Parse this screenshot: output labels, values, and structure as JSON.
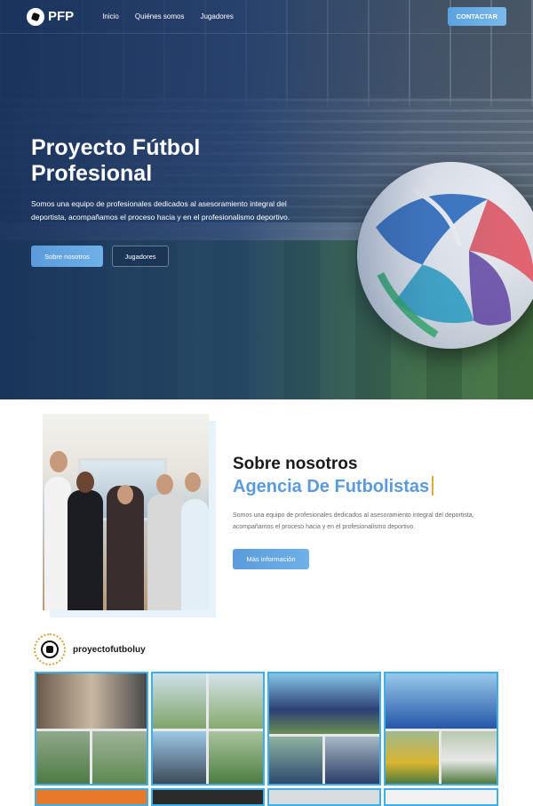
{
  "nav": {
    "logo_text": "PFP",
    "links": [
      "Inicio",
      "Quiénes somos",
      "Jugadores"
    ],
    "cta": "CONTACTAR"
  },
  "hero": {
    "title_line1": "Proyecto Fútbol",
    "title_line2": "Profesional",
    "description": "Somos una equipo de profesionales dedicados al asesoramiento integral del deportista, acompañamos el proceso hacia y en el profesionalismo deportivo.",
    "primary_button": "Sobre nosotros",
    "secondary_button": "Jugadores"
  },
  "about": {
    "title": "Sobre nosotros",
    "subtitle": "Agencia De Futbolistas",
    "description": "Somos una equipo de profesionales dedicados al asesoramiento integral del deportista, acompañamos el proceso hacia y en el profesionalismo deportivo.",
    "button": "Más información"
  },
  "instagram": {
    "handle": "proyectofutboluy"
  },
  "colors": {
    "accent": "#5b9bdc",
    "hero_overlay": "#1e3c6e",
    "tile_border": "#3fb0e6",
    "caret": "#e0a93b"
  }
}
